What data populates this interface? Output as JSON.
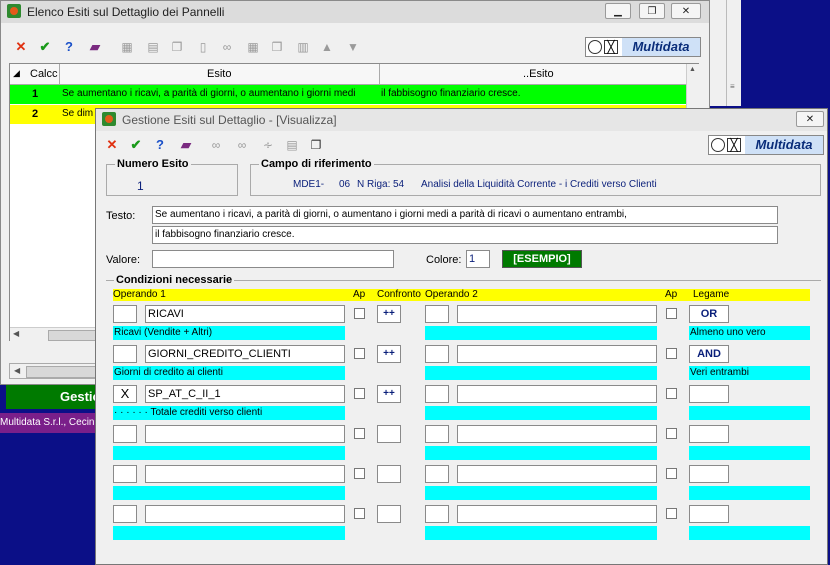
{
  "back_window": {
    "title": "Elenco Esiti sul Dettaglio dei Pannelli",
    "columns": [
      "Calcc",
      "Esito",
      "..Esito"
    ],
    "rows": [
      {
        "num": "1",
        "text": "Se aumentano i ricavi, a  parità di giorni, o aumentano i giorni medi",
        "text2": "il fabbisogno finanziario cresce."
      },
      {
        "num": "2",
        "text": "Se dim",
        "text2": ""
      }
    ],
    "button_label": "Gestio",
    "status_text": "Multidata S.r.l., Cecin"
  },
  "logo_text": "Multidata",
  "front_window": {
    "title": "Gestione Esiti sul Dettaglio - [Visualizza]",
    "numero_esito_label": "Numero Esito",
    "numero_esito_value": "1",
    "campo_label": "Campo di riferimento",
    "campo_code": "MDE1-",
    "campo_num": "06",
    "campo_riga_label": "N Riga:",
    "campo_riga_value": "54",
    "campo_desc": "Analisi della Liquidità Corrente - i Crediti verso Clienti",
    "testo_label": "Testo:",
    "testo_line1": "Se aumentano i ricavi, a  parità di giorni, o aumentano i giorni medi a parità di ricavi o aumentano entrambi,",
    "testo_line2": "il fabbisogno finanziario cresce.",
    "valore_label": "Valore:",
    "valore_value": "",
    "colore_label": "Colore:",
    "colore_value": "1",
    "esempio_label": "[ESEMPIO]",
    "condizioni_label": "Condizioni necessarie",
    "headers": {
      "operando1": "Operando 1",
      "ap": "Ap",
      "confronto": "Confronto",
      "operando2": "Operando 2",
      "ap2": "Ap",
      "legame": "Legame"
    },
    "conditions": [
      {
        "x": "",
        "op1": "RICAVI",
        "desc1": "Ricavi (Vendite + Altri)",
        "confronto": "++",
        "op2": "",
        "desc2": "",
        "legame": "OR",
        "legame_desc": "Almeno uno vero"
      },
      {
        "x": "",
        "op1": "GIORNI_CREDITO_CLIENTI",
        "desc1": "Giorni di credito ai clienti",
        "confronto": "++",
        "op2": "",
        "desc2": "",
        "legame": "AND",
        "legame_desc": "Veri entrambi"
      },
      {
        "x": "X",
        "op1": "SP_AT_C_II_1",
        "desc1": "· · · · · · Totale crediti verso clienti",
        "confronto": "++",
        "op2": "",
        "desc2": "",
        "legame": "",
        "legame_desc": ""
      },
      {
        "x": "",
        "op1": "",
        "desc1": "",
        "confronto": "",
        "op2": "",
        "desc2": "",
        "legame": "",
        "legame_desc": ""
      },
      {
        "x": "",
        "op1": "",
        "desc1": "",
        "confronto": "",
        "op2": "",
        "desc2": "",
        "legame": "",
        "legame_desc": ""
      },
      {
        "x": "",
        "op1": "",
        "desc1": "",
        "confronto": "",
        "op2": "",
        "desc2": "",
        "legame": "",
        "legame_desc": ""
      }
    ]
  },
  "colors": {
    "row_selected": "#00ff00",
    "row_yellow": "#ffff00",
    "cyan": "#00ffff",
    "header_yellow": "#ffff00",
    "esempio_bg": "#007a00"
  }
}
